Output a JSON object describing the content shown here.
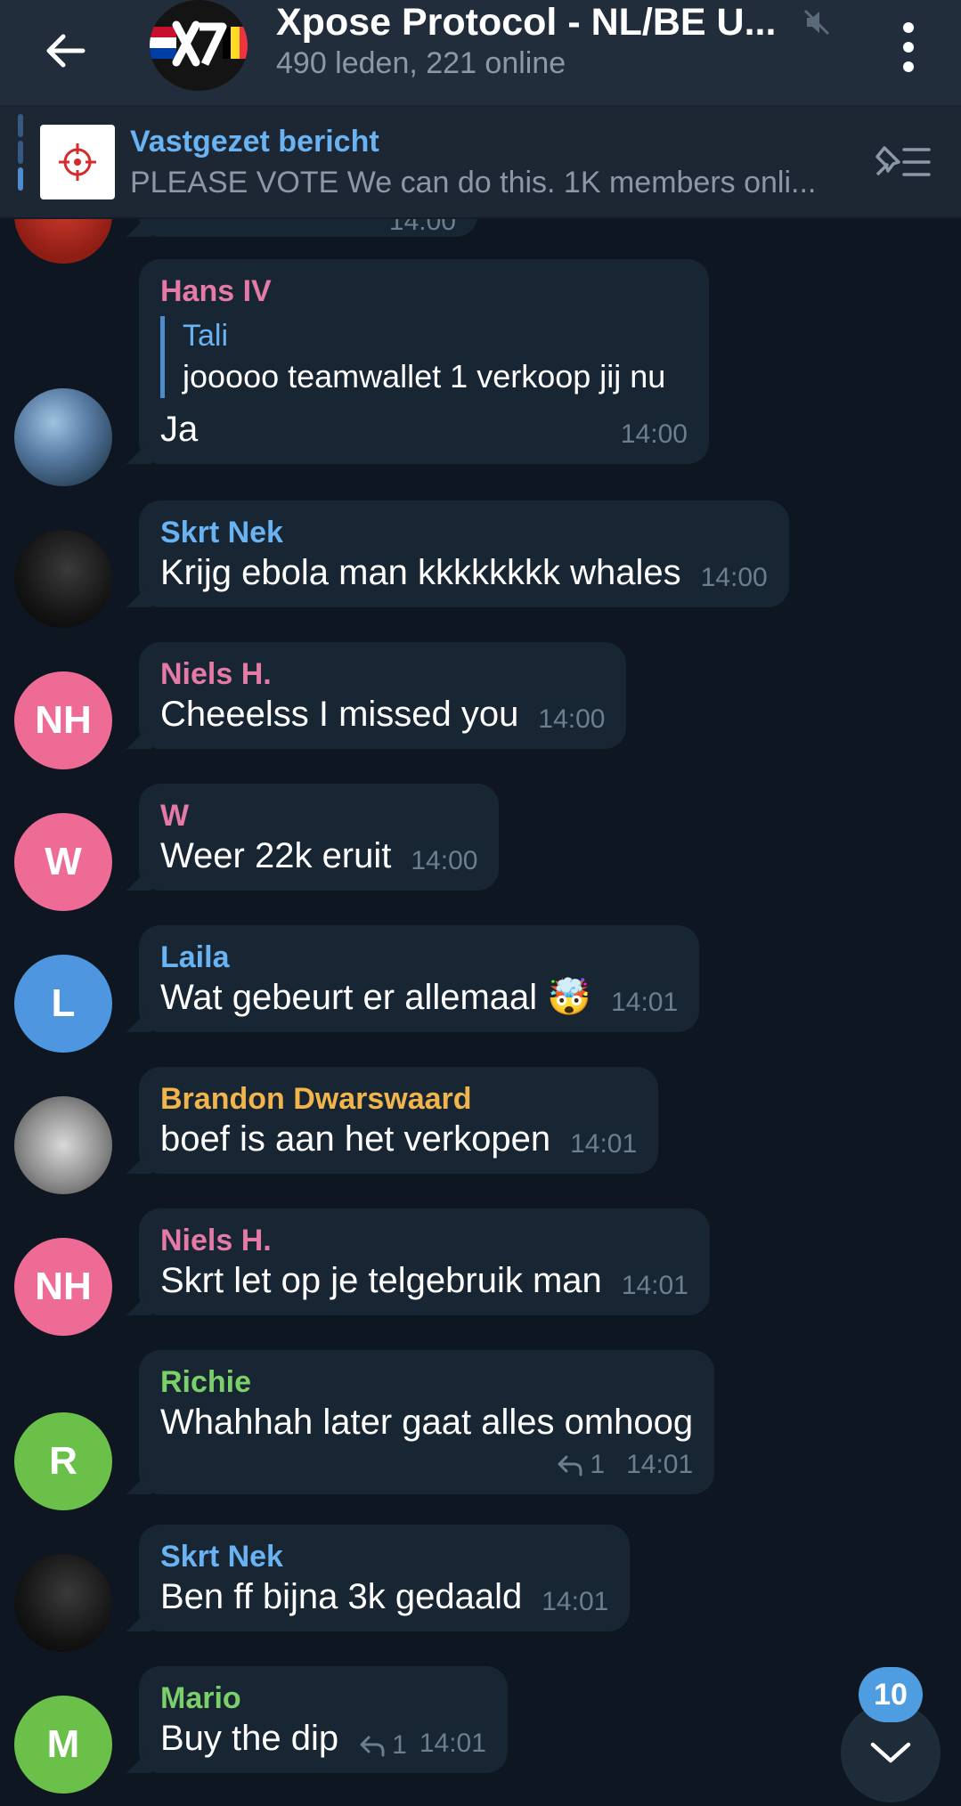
{
  "header": {
    "title": "Xpose Protocol - NL/BE U...",
    "subtitle": "490 leden, 221 online",
    "avatar_text": "X7",
    "muted": true
  },
  "pinned": {
    "label": "Vastgezet bericht",
    "text": "PLEASE VOTE  We can do this. 1K members onli..."
  },
  "partial_top": {
    "time": "14:00"
  },
  "messages": [
    {
      "sender": "Hans IV",
      "sender_color": "#e57aa6",
      "reply_to_name": "Tali",
      "reply_to_text": "jooooo teamwallet 1 verkoop jij nu",
      "text": "Ja",
      "time": "14:00",
      "avatar_type": "photo-anime"
    },
    {
      "sender": "Skrt Nek",
      "sender_color": "#6ab3f3",
      "text": "Krijg ebola man kkkkkkkk whales",
      "time": "14:00",
      "avatar_type": "photo-dark"
    },
    {
      "sender": "Niels H.",
      "sender_color": "#e57aa6",
      "text": "Cheeelss I missed you",
      "time": "14:00",
      "avatar_initials": "NH",
      "avatar_color": "#ee6b96"
    },
    {
      "sender": "W",
      "sender_color": "#e57aa6",
      "text": "Weer 22k eruit",
      "time": "14:00",
      "avatar_initials": "W",
      "avatar_color": "#ee6b96"
    },
    {
      "sender": "Laila",
      "sender_color": "#6ab3f3",
      "text": "Wat gebeurt er allemaal 🤯",
      "time": "14:01",
      "avatar_initials": "L",
      "avatar_color": "#4f96e0"
    },
    {
      "sender": "Brandon Dwarswaard",
      "sender_color": "#f2b54c",
      "text": "boef is aan het verkopen",
      "time": "14:01",
      "avatar_type": "photo-couple"
    },
    {
      "sender": "Niels H.",
      "sender_color": "#e57aa6",
      "text": "Skrt let op je telgebruik man",
      "time": "14:01",
      "avatar_initials": "NH",
      "avatar_color": "#ee6b96"
    },
    {
      "sender": "Richie",
      "sender_color": "#7bd06a",
      "text": "Whahhah later gaat alles omhoog",
      "time": "14:01",
      "replies": "1",
      "avatar_initials": "R",
      "avatar_color": "#6bc049"
    },
    {
      "sender": "Skrt Nek",
      "sender_color": "#6ab3f3",
      "text": "Ben ff bijna 3k gedaald",
      "time": "14:01",
      "avatar_type": "photo-dark"
    },
    {
      "sender": "Mario",
      "sender_color": "#7bd06a",
      "text": "Buy the dip",
      "time": "14:01",
      "replies": "1",
      "avatar_initials": "M",
      "avatar_color": "#6bc049"
    }
  ],
  "scroll_button": {
    "unread_count": "10"
  }
}
